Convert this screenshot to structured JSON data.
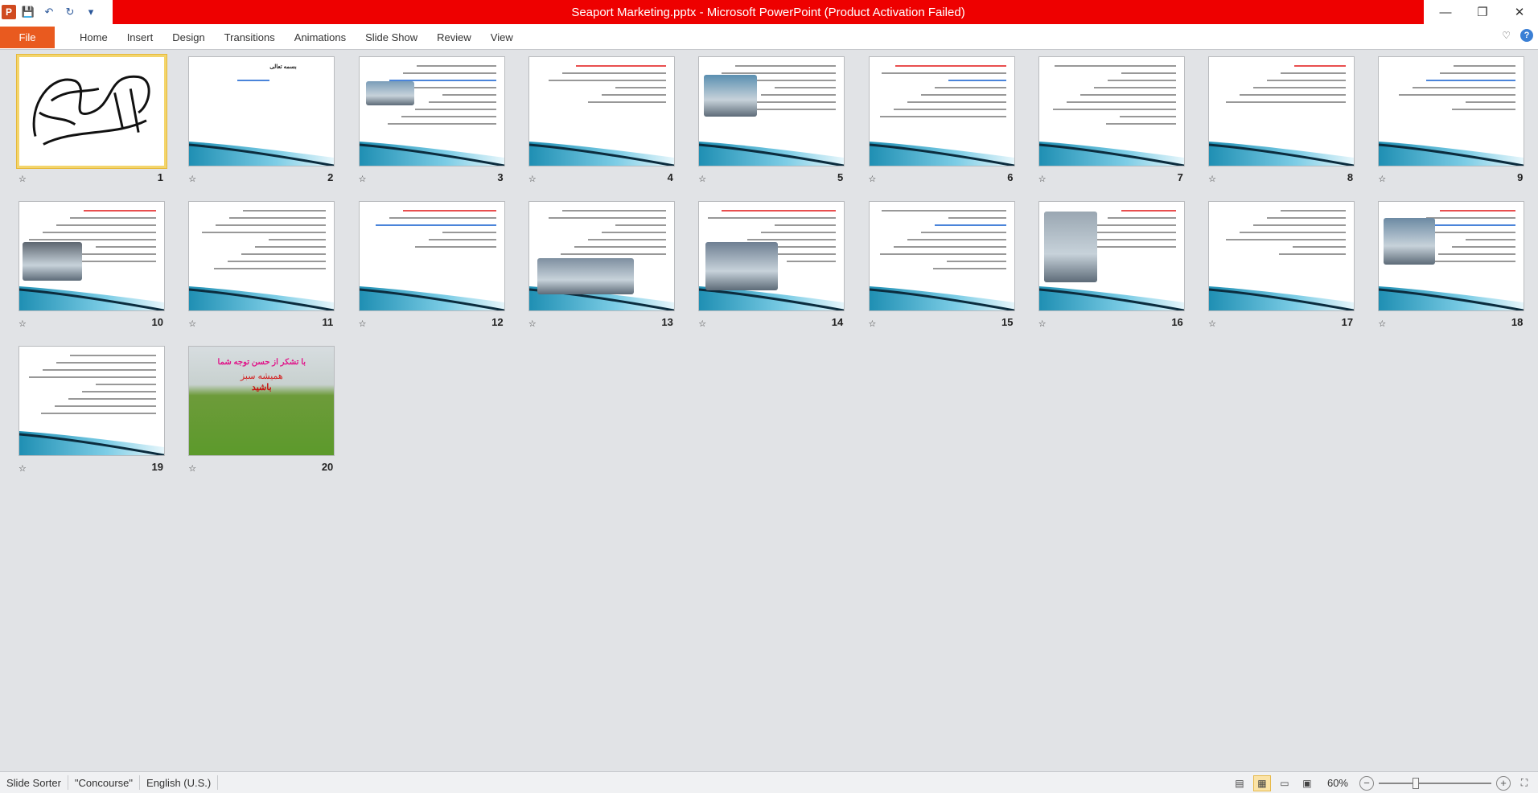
{
  "window": {
    "title": "Seaport Marketing.pptx - Microsoft PowerPoint (Product Activation Failed)",
    "minimize": "—",
    "restore": "❐",
    "close": "✕"
  },
  "qat": {
    "app_icon": "P",
    "save": "💾",
    "undo": "↶",
    "redo": "↻",
    "customize": "▾"
  },
  "ribbon": {
    "file": "File",
    "tabs": [
      "Home",
      "Insert",
      "Design",
      "Transitions",
      "Animations",
      "Slide Show",
      "Review",
      "View"
    ],
    "collapse": "♡",
    "help": "?"
  },
  "slides": [
    {
      "number": "1",
      "selected": true
    },
    {
      "number": "2"
    },
    {
      "number": "3"
    },
    {
      "number": "4"
    },
    {
      "number": "5"
    },
    {
      "number": "6"
    },
    {
      "number": "7"
    },
    {
      "number": "8"
    },
    {
      "number": "9"
    },
    {
      "number": "10"
    },
    {
      "number": "11"
    },
    {
      "number": "12"
    },
    {
      "number": "13"
    },
    {
      "number": "14"
    },
    {
      "number": "15"
    },
    {
      "number": "16"
    },
    {
      "number": "17"
    },
    {
      "number": "18"
    },
    {
      "number": "19"
    },
    {
      "number": "20"
    }
  ],
  "slide_texts": {
    "s2_title": "بسمه تعالی",
    "s20_line1": "با تشکر از حسن توجه شما",
    "s20_line2": "همیشه سبز",
    "s20_line3": "باشید"
  },
  "statusbar": {
    "view": "Slide Sorter",
    "theme": "\"Concourse\"",
    "language": "English (U.S.)",
    "zoom": "60%"
  },
  "icons": {
    "star": "star-transition-icon"
  }
}
